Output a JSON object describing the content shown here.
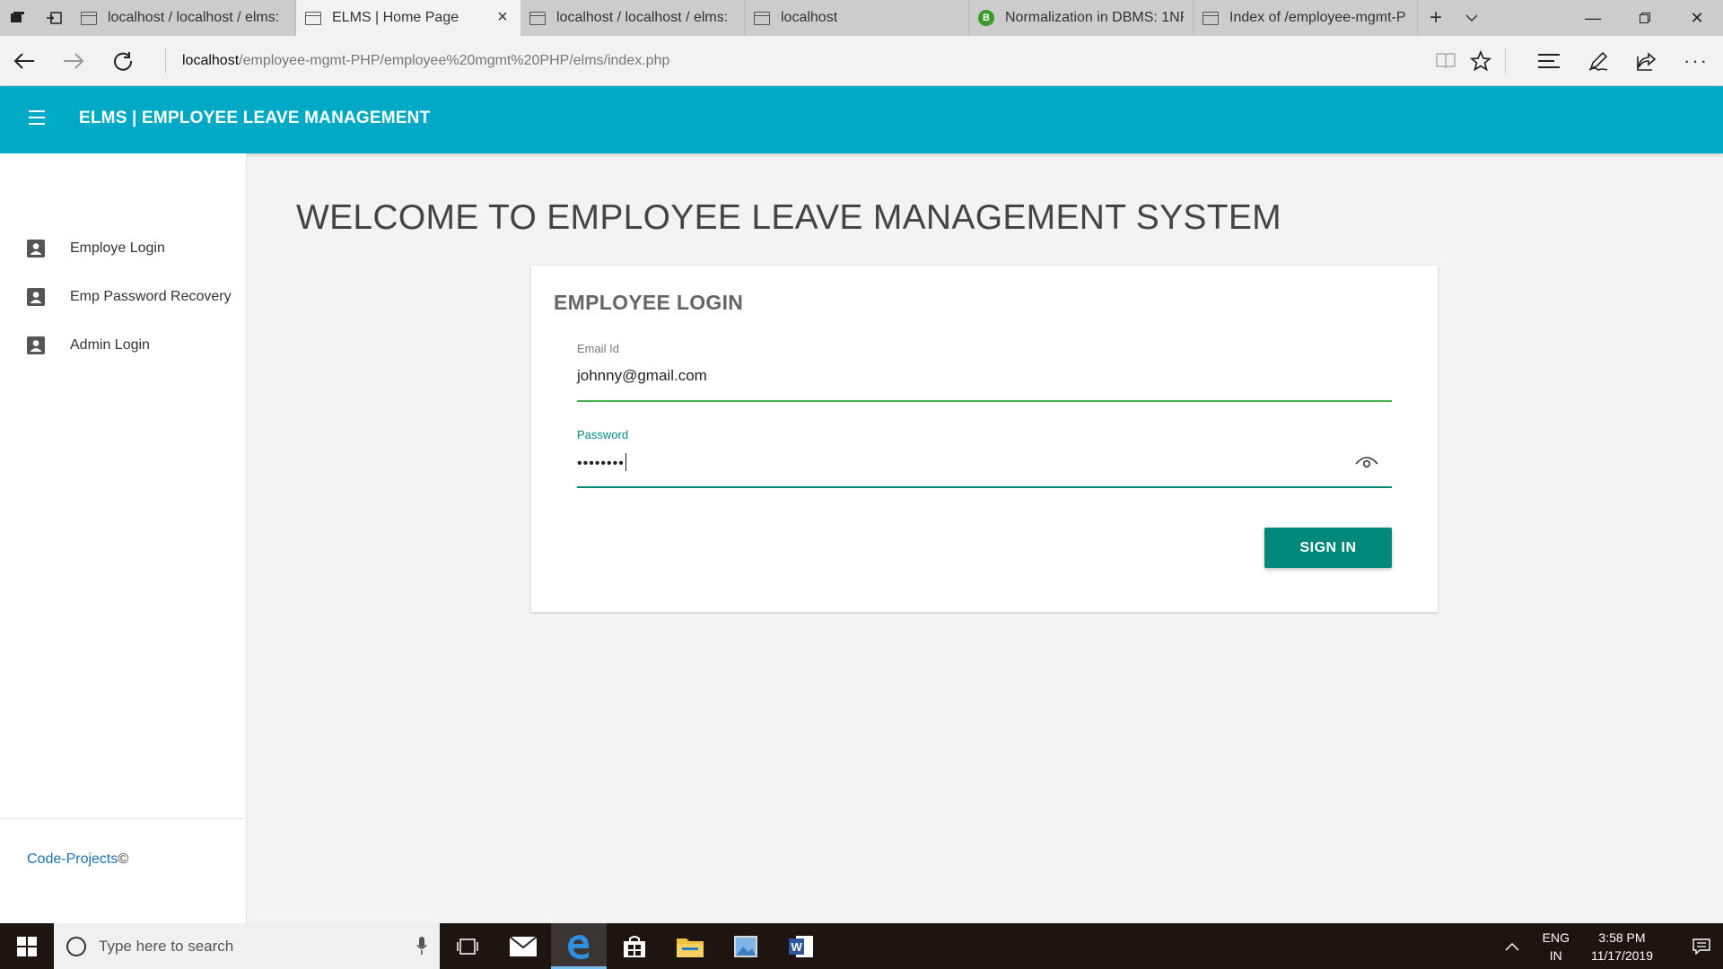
{
  "browser": {
    "tabs": [
      {
        "title": "localhost / localhost / elms:",
        "active": false
      },
      {
        "title": "ELMS | Home Page",
        "active": true
      },
      {
        "title": "localhost / localhost / elms:",
        "active": false
      },
      {
        "title": "localhost",
        "active": false
      },
      {
        "title": "Normalization in DBMS: 1NF",
        "active": false,
        "favicon_letter": "B"
      },
      {
        "title": "Index of /employee-mgmt-P",
        "active": false
      }
    ],
    "address": {
      "host": "localhost",
      "path": "/employee-mgmt-PHP/employee%20mgmt%20PHP/elms/index.php"
    }
  },
  "header": {
    "title": "ELMS | EMPLOYEE LEAVE MANAGEMENT"
  },
  "sidebar": {
    "items": [
      {
        "label": "Employe Login"
      },
      {
        "label": "Emp Password Recovery"
      },
      {
        "label": "Admin Login"
      }
    ],
    "footer": {
      "link": "Code-Projects",
      "symbol": "©"
    }
  },
  "main": {
    "welcome": "WELCOME TO EMPLOYEE LEAVE MANAGEMENT SYSTEM",
    "login": {
      "title": "EMPLOYEE LOGIN",
      "email_label": "Email Id",
      "email_value": "johnny@gmail.com",
      "password_label": "Password",
      "password_masked": "••••••••",
      "submit_label": "SIGN IN"
    }
  },
  "taskbar": {
    "search_placeholder": "Type here to search",
    "lang_top": "ENG",
    "lang_bottom": "IN",
    "time": "3:58 PM",
    "date": "11/17/2019"
  },
  "colors": {
    "header": "#00aac6",
    "button": "#00897b",
    "email_underline": "#4caf50",
    "password_underline": "#00897b"
  }
}
